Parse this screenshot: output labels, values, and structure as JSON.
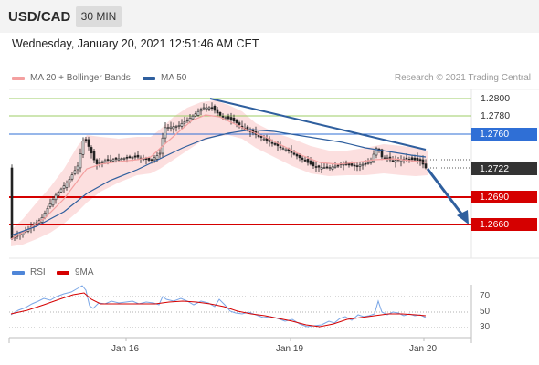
{
  "header": {
    "symbol": "USD/CAD",
    "timeframe": "30 MIN",
    "datetime": "Wednesday, January 20, 2021 12:51:46 AM CET"
  },
  "legend_main": {
    "ma20_label": "MA 20 + Bollinger Bands",
    "ma50_label": "MA 50",
    "ma20_color": "#f08080",
    "ma50_color": "#2f5f9e",
    "credit": "Research © 2021 Trading Central"
  },
  "price_levels": {
    "r2": "1.2800",
    "r1": "1.2780",
    "pivot": "1.2760",
    "last": "1.2722",
    "s1": "1.2690",
    "s2": "1.2660",
    "resistance_color": "#7cb342",
    "pivot_color": "#2f6fd6",
    "support_color": "#d50000",
    "last_color": "#333333"
  },
  "legend_rsi": {
    "rsi_label": "RSI",
    "ma9_label": "9MA",
    "rsi_color": "#4f86d8",
    "ma9_color": "#d50000"
  },
  "rsi_axis": {
    "t70": "70",
    "t50": "50",
    "t30": "30"
  },
  "x_axis": {
    "d1": "Jan 16",
    "d2": "Jan 19",
    "d3": "Jan 20"
  }
}
